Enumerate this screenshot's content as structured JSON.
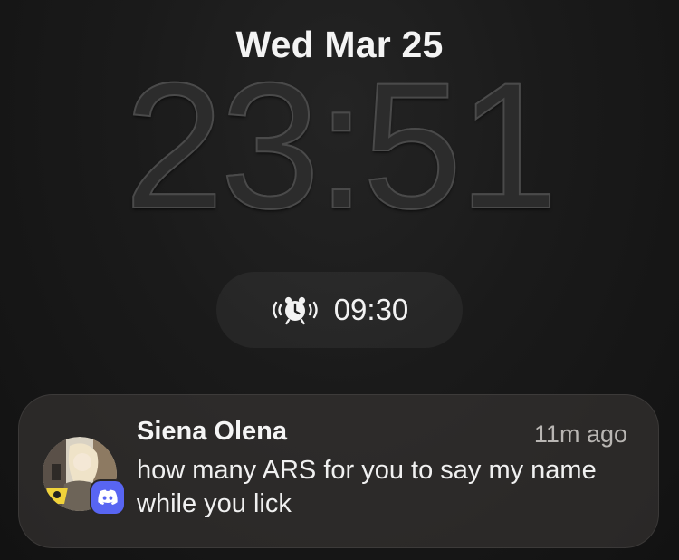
{
  "lockscreen": {
    "date": "Wed Mar 25",
    "time": "23:51"
  },
  "alarm": {
    "icon": "alarm-clock-icon",
    "time": "09:30"
  },
  "notification": {
    "sender": "Siena Olena",
    "timestamp": "11m ago",
    "message": "how many ARS for you to say my name while you lick",
    "app_icon": "discord-icon",
    "app_color": "#5865f2"
  }
}
